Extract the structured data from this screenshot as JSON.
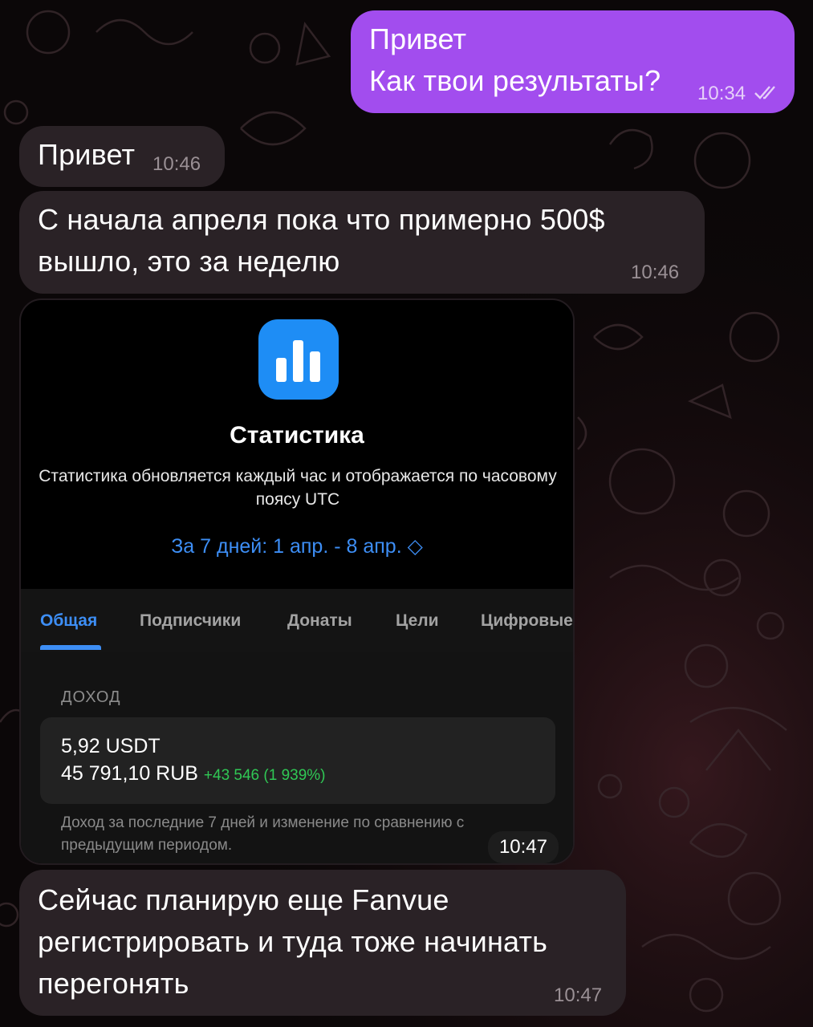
{
  "messages": {
    "m1": {
      "line1": "Привет",
      "line2": "Как твои результаты?",
      "time": "10:34"
    },
    "m2": {
      "text": "Привет",
      "time": "10:46"
    },
    "m3": {
      "line1": "С начала апреля пока что примерно 500$",
      "line2": "вышло, это за неделю",
      "time": "10:46"
    },
    "m4": {
      "time": "10:47"
    },
    "m5": {
      "line1": "Сейчас планирую еще Fanvue",
      "line2": "регистрировать и туда тоже начинать",
      "line3": "перегонять",
      "time": "10:47"
    }
  },
  "stats": {
    "title": "Статистика",
    "description": "Статистика обновляется каждый час и отображается по часовому поясу UTC",
    "period": "За 7 дней: 1 апр. - 8 апр. ◇",
    "tabs": [
      "Общая",
      "Подписчики",
      "Донаты",
      "Цели",
      "Цифровые"
    ],
    "active_tab": "Общая",
    "section_label": "ДОХОД",
    "income_usdt": "5,92 USDT",
    "income_rub": "45 791,10 RUB",
    "income_delta": "+43 546 (1 939%)",
    "note": "Доход за последние 7 дней и изменение по сравнению с предыдущим периодом."
  },
  "colors": {
    "outgoing_bubble": "#a24dee",
    "incoming_bubble": "#2a2226",
    "accent_blue": "#3d8ef5",
    "positive_green": "#30c855",
    "background": "#0b0708"
  },
  "icons": {
    "read_receipt": "double-check-icon",
    "stats_app": "bar-chart-icon"
  }
}
